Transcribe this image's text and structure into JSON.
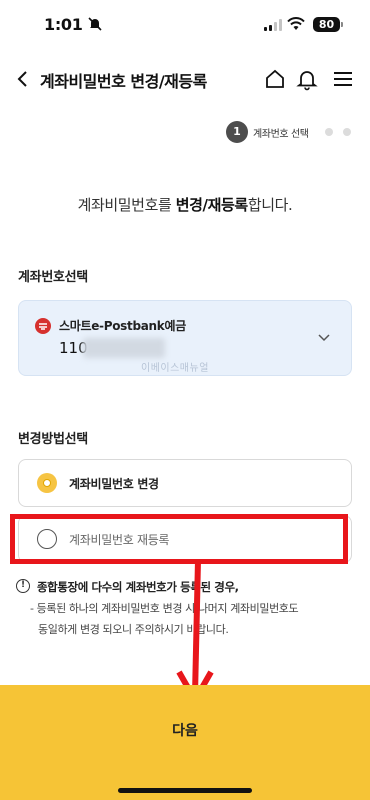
{
  "status_bar": {
    "time": "1:01",
    "battery": "80"
  },
  "header": {
    "title": "계좌비밀번호 변경/재등록"
  },
  "step": {
    "number": "1",
    "label": "계좌번호 선택"
  },
  "headline": {
    "prefix": "계좌비밀번호를 ",
    "emphasis": "변경/재등록",
    "suffix": "합니다."
  },
  "account_section": {
    "title": "계좌번호선택",
    "account_name": "스마트e-Postbank예금",
    "account_number_prefix": "110",
    "watermark": "이베이스매뉴얼"
  },
  "method_section": {
    "title": "변경방법선택",
    "options": [
      {
        "label": "계좌비밀번호 변경",
        "selected": true
      },
      {
        "label": "계좌비밀번호 재등록",
        "selected": false
      }
    ]
  },
  "notice": {
    "title": "종합통장에 다수의 계좌번호가 등록된 경우,",
    "body_line1": "- 등록된 하나의 계좌비밀번호 변경 시 나머지 계좌비밀번호도",
    "body_line2": "동일하게 변경 되오니 주의하시기 바랍니다."
  },
  "next_button": {
    "label": "다음"
  },
  "colors": {
    "accent": "#f6c436",
    "highlight": "#e8161b",
    "account_bg": "#e9f1fb"
  },
  "icons": [
    "back-icon",
    "home-icon",
    "bell-icon",
    "menu-icon",
    "chevron-down-icon",
    "info-icon",
    "muted-bell-icon",
    "signal-icon",
    "wifi-icon",
    "battery-icon"
  ]
}
